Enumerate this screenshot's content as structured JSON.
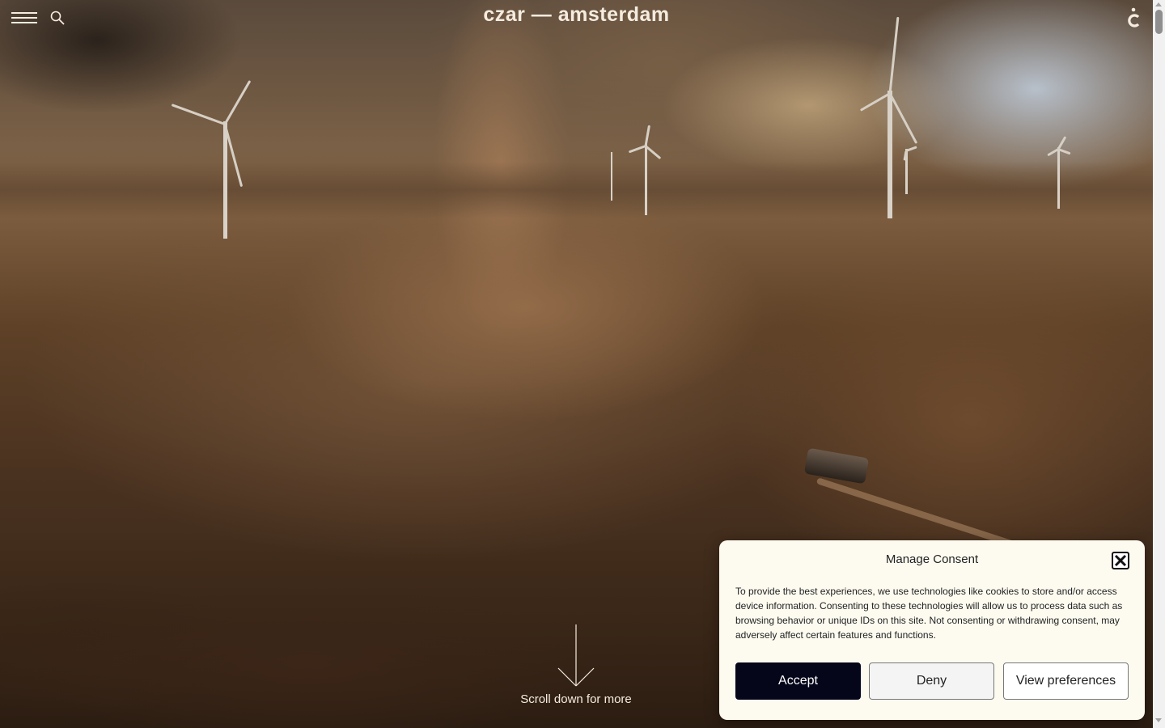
{
  "header": {
    "brand": "czar — amsterdam",
    "menu_icon": "hamburger-menu-icon",
    "search_icon": "search-icon",
    "brand_mark_icon": "czar-c-logo-icon"
  },
  "hero": {
    "scroll_cue_label": "Scroll down for more",
    "scroll_cue_icon": "arrow-down-icon"
  },
  "consent": {
    "title": "Manage Consent",
    "body": "To provide the best experiences, we use technologies like cookies to store and/or access device information. Consenting to these technologies will allow us to process data such as browsing behavior or unique IDs on this site. Not consenting or withdrawing consent, may adversely affect certain features and functions.",
    "close_icon": "close-icon",
    "accept_label": "Accept",
    "deny_label": "Deny",
    "preferences_label": "View preferences"
  },
  "colors": {
    "header_text": "#f5ecdf",
    "consent_background": "#fdfbf0",
    "accept_background": "#05061a"
  }
}
